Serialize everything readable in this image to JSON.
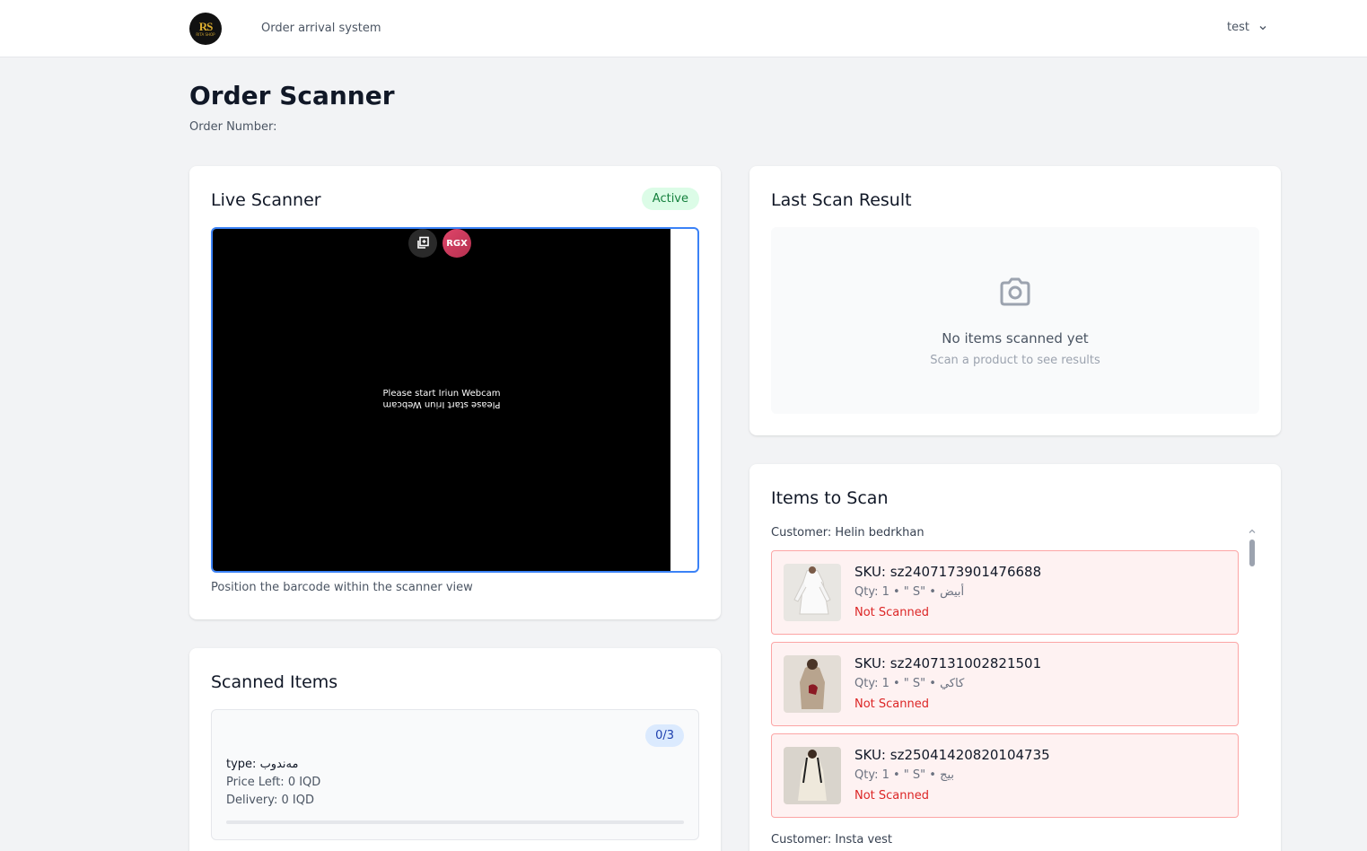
{
  "header": {
    "logo_text": "RS",
    "logo_subtext": "RITA SHOP",
    "app_title": "Order arrival system",
    "user_name": "test"
  },
  "page": {
    "title": "Order Scanner",
    "order_number_label": "Order Number:"
  },
  "live_scanner": {
    "title": "Live Scanner",
    "status_badge": "Active",
    "video_message": "Please start Iriun Webcam",
    "overlay_rgx_label": "RGX",
    "hint": "Position the barcode within the scanner view"
  },
  "scanned_items": {
    "title": "Scanned Items",
    "count": "0/3",
    "type_line": "type: مەندوب",
    "price_left": "Price Left: 0 IQD",
    "delivery": "Delivery: 0 IQD",
    "progress": 0
  },
  "last_scan": {
    "title": "Last Scan Result",
    "empty_title": "No items scanned yet",
    "empty_subtitle": "Scan a product to see results"
  },
  "items_to_scan": {
    "title": "Items to Scan",
    "customers": [
      "Customer: Helin bedrkhan",
      "Customer: Insta vest"
    ],
    "items": [
      {
        "sku": "SKU: sz2407173901476688",
        "meta": "Qty: 1  •  \" S\"  •  أبيض",
        "status": "Not Scanned"
      },
      {
        "sku": "SKU: sz2407131002821501",
        "meta": "Qty: 1  •  \" S\"  •  كاكي",
        "status": "Not Scanned"
      },
      {
        "sku": "SKU: sz25041420820104735",
        "meta": "Qty: 1  •  \" S\"  •  بيج",
        "status": "Not Scanned"
      }
    ]
  },
  "colors": {
    "accent": "#3b82f6",
    "active_badge": "#15803d",
    "not_scanned": "#dc2626"
  }
}
